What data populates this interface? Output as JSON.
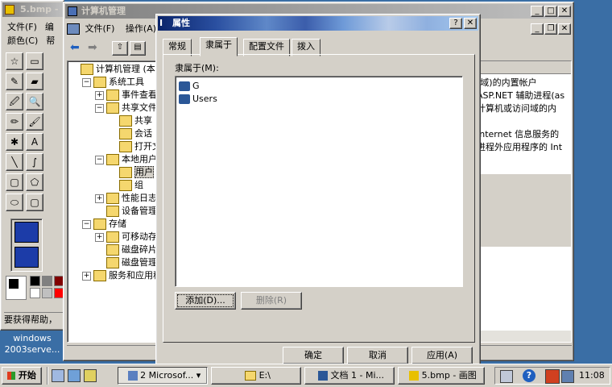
{
  "paint": {
    "title": "5.bmp - ...",
    "menu1": [
      "文件(F)",
      "编"
    ],
    "menu2": [
      "颜色(C)",
      "帮"
    ],
    "status": "要获得帮助，",
    "tools": [
      "☆",
      "▭",
      "✎",
      "▰",
      "🖉",
      "🔍",
      "✏",
      "🖌",
      "✱",
      "A",
      "╲",
      "∫",
      "▢",
      "⬠",
      "⬭",
      "▢"
    ]
  },
  "tooltip": [
    "windows",
    "2003serve..."
  ],
  "mmc": {
    "title": "计算机管理",
    "menu": [
      "文件(F)",
      "操作(A)"
    ],
    "tree": [
      {
        "label": "计算机管理 (本地",
        "depth": 0,
        "pm": ""
      },
      {
        "label": "系统工具",
        "depth": 1,
        "pm": "−"
      },
      {
        "label": "事件查看器",
        "depth": 2,
        "pm": "+"
      },
      {
        "label": "共享文件夹",
        "depth": 2,
        "pm": "−"
      },
      {
        "label": "共享",
        "depth": 3,
        "pm": ""
      },
      {
        "label": "会话",
        "depth": 3,
        "pm": ""
      },
      {
        "label": "打开文件",
        "depth": 3,
        "pm": ""
      },
      {
        "label": "本地用户和组",
        "depth": 2,
        "pm": "−"
      },
      {
        "label": "用户",
        "depth": 3,
        "pm": ""
      },
      {
        "label": "组",
        "depth": 3,
        "pm": ""
      },
      {
        "label": "性能日志和警报",
        "depth": 2,
        "pm": "+"
      },
      {
        "label": "设备管理器",
        "depth": 2,
        "pm": ""
      },
      {
        "label": "存储",
        "depth": 1,
        "pm": "−"
      },
      {
        "label": "可移动存储",
        "depth": 2,
        "pm": "+"
      },
      {
        "label": "磁盘碎片整理",
        "depth": 2,
        "pm": ""
      },
      {
        "label": "磁盘管理",
        "depth": 2,
        "pm": ""
      },
      {
        "label": "服务和应用程序",
        "depth": 1,
        "pm": "+"
      }
    ],
    "right": [
      "(域)的内置帐户",
      "ASP.NET 辅助进程(as",
      "计算机或访问域的内",
      "",
      "Internet 信息服务的",
      "进程外应用程序的 Int"
    ]
  },
  "dialog": {
    "title": "属性",
    "tabs": [
      "常规",
      "隶属于",
      "配置文件",
      "拨入"
    ],
    "member_label": "隶属于(M):",
    "members": [
      "G",
      "Users"
    ],
    "add": "添加(D)...",
    "remove": "删除(R)",
    "ok": "确定",
    "cancel": "取消",
    "apply": "应用(A)"
  },
  "taskbar": {
    "start": "开始",
    "items": [
      "2 Microsof...",
      "E:\\",
      "文档 1 - Mi...",
      "5.bmp - 画图"
    ],
    "clock": "11:08"
  }
}
